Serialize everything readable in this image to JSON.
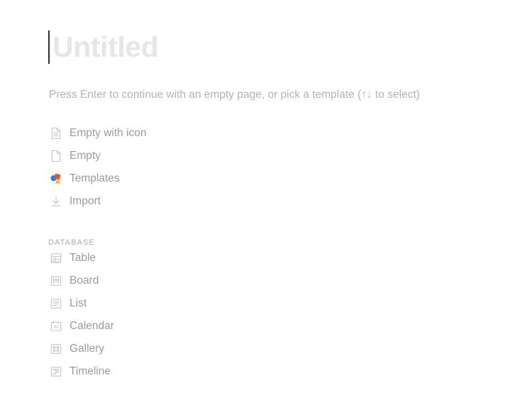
{
  "page": {
    "title_placeholder": "Untitled",
    "hint": "Press Enter to continue with an empty page, or pick a template (↑↓ to select)"
  },
  "colors": {
    "background": "#ffffff",
    "title_placeholder": "#e6e6e6",
    "caret": "#2e2e2e",
    "hint_text": "#b3b3b3",
    "item_label": "#9b9b9b",
    "item_icon": "#c4c4c4",
    "section_header": "#aaaaaa",
    "templates_blue": "#2b7de0",
    "templates_red": "#e8503a",
    "templates_yellow": "#f5b731"
  },
  "menu": {
    "primary_items": [
      {
        "label": "Empty with icon",
        "icon": "document-lines-icon"
      },
      {
        "label": "Empty",
        "icon": "document-blank-icon"
      },
      {
        "label": "Templates",
        "icon": "shapes-color-icon"
      },
      {
        "label": "Import",
        "icon": "download-arrow-icon"
      }
    ],
    "database_section": {
      "header": "DATABASE",
      "items": [
        {
          "label": "Table",
          "icon": "table-grid-icon"
        },
        {
          "label": "Board",
          "icon": "board-kanban-icon"
        },
        {
          "label": "List",
          "icon": "list-lines-icon"
        },
        {
          "label": "Calendar",
          "icon": "calendar-31-icon",
          "day_number": "31"
        },
        {
          "label": "Gallery",
          "icon": "gallery-grid-icon"
        },
        {
          "label": "Timeline",
          "icon": "timeline-bars-icon"
        }
      ]
    }
  }
}
